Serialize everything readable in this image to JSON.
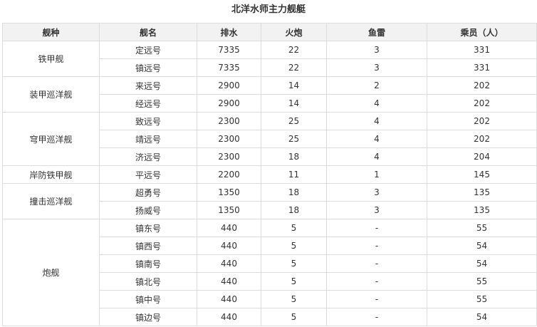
{
  "title": "北洋水师主力舰艇",
  "headers": [
    "舰种",
    "舰名",
    "排水",
    "火炮",
    "鱼雷",
    "乘员（人）"
  ],
  "groups": [
    {
      "type": "铁甲舰",
      "rows": [
        [
          "定远号",
          "7335",
          "22",
          "3",
          "331"
        ],
        [
          "镇远号",
          "7335",
          "22",
          "3",
          "331"
        ]
      ]
    },
    {
      "type": "装甲巡洋舰",
      "rows": [
        [
          "来远号",
          "2900",
          "14",
          "2",
          "202"
        ],
        [
          "经远号",
          "2900",
          "14",
          "4",
          "202"
        ]
      ]
    },
    {
      "type": "穹甲巡洋舰",
      "rows": [
        [
          "致远号",
          "2300",
          "25",
          "4",
          "202"
        ],
        [
          "靖远号",
          "2300",
          "25",
          "4",
          "202"
        ],
        [
          "济远号",
          "2300",
          "18",
          "4",
          "204"
        ]
      ]
    },
    {
      "type": "岸防铁甲舰",
      "rows": [
        [
          "平远号",
          "2200",
          "11",
          "1",
          "145"
        ]
      ]
    },
    {
      "type": "撞击巡洋舰",
      "rows": [
        [
          "超勇号",
          "1350",
          "18",
          "3",
          "135"
        ],
        [
          "扬威号",
          "1350",
          "18",
          "3",
          "135"
        ]
      ]
    },
    {
      "type": "炮舰",
      "rows": [
        [
          "镇东号",
          "440",
          "5",
          "-",
          "55"
        ],
        [
          "镇西号",
          "440",
          "5",
          "-",
          "54"
        ],
        [
          "镇南号",
          "440",
          "5",
          "-",
          "54"
        ],
        [
          "镇北号",
          "440",
          "5",
          "-",
          "55"
        ],
        [
          "镇中号",
          "440",
          "5",
          "-",
          "55"
        ],
        [
          "镇边号",
          "440",
          "5",
          "-",
          "54"
        ]
      ]
    }
  ]
}
